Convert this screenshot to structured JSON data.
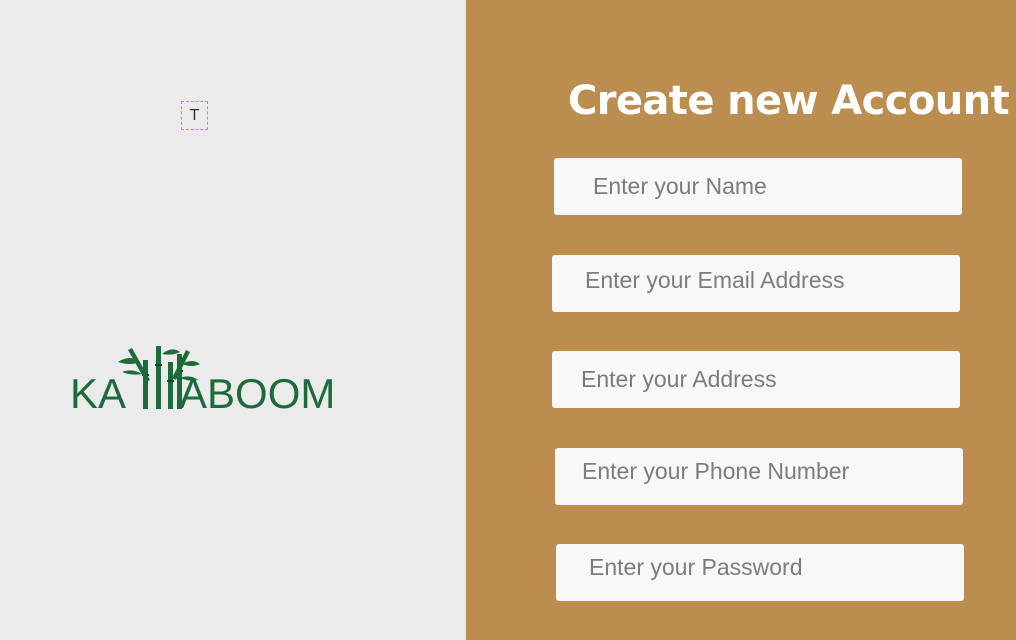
{
  "canvas": {
    "text_tool_glyph": "T"
  },
  "logo": {
    "text": "KA  ABOOM",
    "prefix": "KA",
    "suffix": "ABOOM",
    "brand_color": "#1d6b3a"
  },
  "form": {
    "title": "Create new Account",
    "fields": {
      "name": {
        "placeholder": "Enter your Name"
      },
      "email": {
        "placeholder": "Enter your Email Address"
      },
      "address": {
        "placeholder": "Enter your Address"
      },
      "phone": {
        "placeholder": "Enter your Phone Number"
      },
      "password": {
        "placeholder": "Enter your Password"
      }
    }
  },
  "colors": {
    "left_background": "#ebebeb",
    "right_background": "#bb8d4f",
    "field_background": "#f8f8f8",
    "title_color": "#ffffff"
  }
}
